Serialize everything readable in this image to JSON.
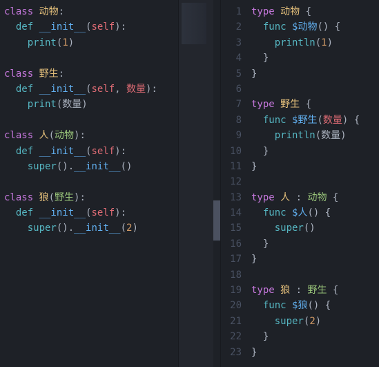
{
  "left": {
    "lines": [
      [
        {
          "t": "class ",
          "c": "kw"
        },
        {
          "t": "动物",
          "c": "cls"
        },
        {
          "t": ":",
          "c": "punc"
        }
      ],
      [
        {
          "t": "  ",
          "c": "punc"
        },
        {
          "t": "def ",
          "c": "fnkw"
        },
        {
          "t": "__init__",
          "c": "name"
        },
        {
          "t": "(",
          "c": "punc"
        },
        {
          "t": "self",
          "c": "self"
        },
        {
          "t": "):",
          "c": "punc"
        }
      ],
      [
        {
          "t": "    ",
          "c": "punc"
        },
        {
          "t": "print",
          "c": "call"
        },
        {
          "t": "(",
          "c": "punc"
        },
        {
          "t": "1",
          "c": "num"
        },
        {
          "t": ")",
          "c": "punc"
        }
      ],
      [],
      [
        {
          "t": "class ",
          "c": "kw"
        },
        {
          "t": "野生",
          "c": "cls"
        },
        {
          "t": ":",
          "c": "punc"
        }
      ],
      [
        {
          "t": "  ",
          "c": "punc"
        },
        {
          "t": "def ",
          "c": "fnkw"
        },
        {
          "t": "__init__",
          "c": "name"
        },
        {
          "t": "(",
          "c": "punc"
        },
        {
          "t": "self",
          "c": "self"
        },
        {
          "t": ", ",
          "c": "punc"
        },
        {
          "t": "数量",
          "c": "self"
        },
        {
          "t": "):",
          "c": "punc"
        }
      ],
      [
        {
          "t": "    ",
          "c": "punc"
        },
        {
          "t": "print",
          "c": "call"
        },
        {
          "t": "(数量)",
          "c": "punc"
        }
      ],
      [],
      [
        {
          "t": "class ",
          "c": "kw"
        },
        {
          "t": "人",
          "c": "cls"
        },
        {
          "t": "(",
          "c": "punc"
        },
        {
          "t": "动物",
          "c": "base"
        },
        {
          "t": "):",
          "c": "punc"
        }
      ],
      [
        {
          "t": "  ",
          "c": "punc"
        },
        {
          "t": "def ",
          "c": "fnkw"
        },
        {
          "t": "__init__",
          "c": "name"
        },
        {
          "t": "(",
          "c": "punc"
        },
        {
          "t": "self",
          "c": "self"
        },
        {
          "t": "):",
          "c": "punc"
        }
      ],
      [
        {
          "t": "    ",
          "c": "punc"
        },
        {
          "t": "super",
          "c": "call"
        },
        {
          "t": "().",
          "c": "punc"
        },
        {
          "t": "__init__",
          "c": "name"
        },
        {
          "t": "()",
          "c": "punc"
        }
      ],
      [],
      [
        {
          "t": "class ",
          "c": "kw"
        },
        {
          "t": "狼",
          "c": "cls"
        },
        {
          "t": "(",
          "c": "punc"
        },
        {
          "t": "野生",
          "c": "base"
        },
        {
          "t": "):",
          "c": "punc"
        }
      ],
      [
        {
          "t": "  ",
          "c": "punc"
        },
        {
          "t": "def ",
          "c": "fnkw"
        },
        {
          "t": "__init__",
          "c": "name"
        },
        {
          "t": "(",
          "c": "punc"
        },
        {
          "t": "self",
          "c": "self"
        },
        {
          "t": "):",
          "c": "punc"
        }
      ],
      [
        {
          "t": "    ",
          "c": "punc"
        },
        {
          "t": "super",
          "c": "call"
        },
        {
          "t": "().",
          "c": "punc"
        },
        {
          "t": "__init__",
          "c": "name"
        },
        {
          "t": "(",
          "c": "punc"
        },
        {
          "t": "2",
          "c": "num"
        },
        {
          "t": ")",
          "c": "punc"
        }
      ]
    ]
  },
  "right": {
    "gutter": [
      "1",
      "2",
      "3",
      "4",
      "5",
      "6",
      "7",
      "8",
      "9",
      "10",
      "11",
      "12",
      "13",
      "14",
      "15",
      "16",
      "17",
      "18",
      "19",
      "20",
      "21",
      "22",
      "23"
    ],
    "lines": [
      [
        {
          "t": "type ",
          "c": "kw"
        },
        {
          "t": "动物",
          "c": "cls"
        },
        {
          "t": " {",
          "c": "punc"
        }
      ],
      [
        {
          "t": "  ",
          "c": "punc"
        },
        {
          "t": "func ",
          "c": "fnkw"
        },
        {
          "t": "$动物",
          "c": "name"
        },
        {
          "t": "() {",
          "c": "punc"
        }
      ],
      [
        {
          "t": "    ",
          "c": "punc"
        },
        {
          "t": "println",
          "c": "call"
        },
        {
          "t": "(",
          "c": "punc"
        },
        {
          "t": "1",
          "c": "num"
        },
        {
          "t": ")",
          "c": "punc"
        }
      ],
      [
        {
          "t": "  }",
          "c": "punc"
        }
      ],
      [
        {
          "t": "}",
          "c": "punc"
        }
      ],
      [],
      [
        {
          "t": "type ",
          "c": "kw"
        },
        {
          "t": "野生",
          "c": "cls"
        },
        {
          "t": " {",
          "c": "punc"
        }
      ],
      [
        {
          "t": "  ",
          "c": "punc"
        },
        {
          "t": "func ",
          "c": "fnkw"
        },
        {
          "t": "$野生",
          "c": "name"
        },
        {
          "t": "(",
          "c": "punc"
        },
        {
          "t": "数量",
          "c": "self"
        },
        {
          "t": ") {",
          "c": "punc"
        }
      ],
      [
        {
          "t": "    ",
          "c": "punc"
        },
        {
          "t": "println",
          "c": "call"
        },
        {
          "t": "(数量)",
          "c": "punc"
        }
      ],
      [
        {
          "t": "  }",
          "c": "punc"
        }
      ],
      [
        {
          "t": "}",
          "c": "punc"
        }
      ],
      [],
      [
        {
          "t": "type ",
          "c": "kw"
        },
        {
          "t": "人",
          "c": "cls"
        },
        {
          "t": " : ",
          "c": "punc"
        },
        {
          "t": "动物",
          "c": "base"
        },
        {
          "t": " {",
          "c": "punc"
        }
      ],
      [
        {
          "t": "  ",
          "c": "punc"
        },
        {
          "t": "func ",
          "c": "fnkw"
        },
        {
          "t": "$人",
          "c": "name"
        },
        {
          "t": "() {",
          "c": "punc"
        }
      ],
      [
        {
          "t": "    ",
          "c": "punc"
        },
        {
          "t": "super",
          "c": "call"
        },
        {
          "t": "()",
          "c": "punc"
        }
      ],
      [
        {
          "t": "  }",
          "c": "punc"
        }
      ],
      [
        {
          "t": "}",
          "c": "punc"
        }
      ],
      [],
      [
        {
          "t": "type ",
          "c": "kw"
        },
        {
          "t": "狼",
          "c": "cls"
        },
        {
          "t": " : ",
          "c": "punc"
        },
        {
          "t": "野生",
          "c": "base"
        },
        {
          "t": " {",
          "c": "punc"
        }
      ],
      [
        {
          "t": "  ",
          "c": "punc"
        },
        {
          "t": "func ",
          "c": "fnkw"
        },
        {
          "t": "$狼",
          "c": "name"
        },
        {
          "t": "() {",
          "c": "punc"
        }
      ],
      [
        {
          "t": "    ",
          "c": "punc"
        },
        {
          "t": "super",
          "c": "call"
        },
        {
          "t": "(",
          "c": "punc"
        },
        {
          "t": "2",
          "c": "num"
        },
        {
          "t": ")",
          "c": "punc"
        }
      ],
      [
        {
          "t": "  }",
          "c": "punc"
        }
      ],
      [
        {
          "t": "}",
          "c": "punc"
        }
      ]
    ]
  }
}
